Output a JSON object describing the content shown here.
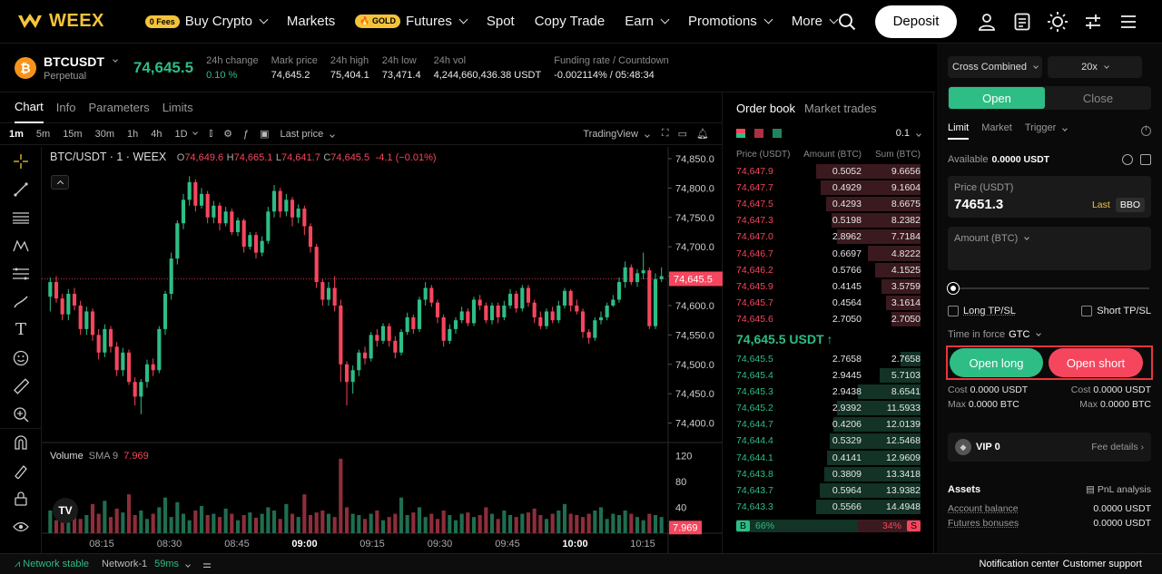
{
  "nav": {
    "logo": "WEEX",
    "fees_badge": "0 Fees",
    "buy_crypto": "Buy Crypto",
    "markets": "Markets",
    "gold_badge": "GOLD",
    "futures": "Futures",
    "spot": "Spot",
    "copy_trade": "Copy Trade",
    "earn": "Earn",
    "promotions": "Promotions",
    "more": "More",
    "deposit": "Deposit"
  },
  "ticker": {
    "symbol": "BTCUSDT",
    "type": "Perpetual",
    "price": "74,645.5",
    "change_label": "24h change",
    "change_value": "0.10 %",
    "mark_label": "Mark price",
    "mark_value": "74,645.2",
    "high_label": "24h high",
    "high_value": "75,404.1",
    "low_label": "24h low",
    "low_value": "73,471.4",
    "vol_label": "24h vol",
    "vol_value": "4,244,660,436.38 USDT",
    "funding_label": "Funding rate / Countdown",
    "funding_value": "-0.002114% / 05:48:34"
  },
  "chart_panel": {
    "tabs": [
      "Chart",
      "Info",
      "Parameters",
      "Limits"
    ],
    "timeframes": [
      "1m",
      "5m",
      "15m",
      "30m",
      "1h",
      "4h",
      "1D"
    ],
    "last_price": "Last price",
    "tradingview": "TradingView",
    "legend_title": "BTC/USDT · 1 · WEEX",
    "ohlc": {
      "o": "74,649.6",
      "h": "74,665.1",
      "l": "74,641.7",
      "c": "74,645.5",
      "chg": "-4.1 (−0.01%)"
    },
    "volume_label": "Volume",
    "sma_label": "SMA 9",
    "sma_value": "7.969",
    "volume_tag": "7.969",
    "price_tag": "74,645.5"
  },
  "chart_data": {
    "type": "candlestick",
    "y_ticks": [
      "74,850.0",
      "74,800.0",
      "74,750.0",
      "74,700.0",
      "74,650.0",
      "74,600.0",
      "74,550.0",
      "74,500.0",
      "74,450.0",
      "74,400.0"
    ],
    "ylim": [
      74370,
      74870
    ],
    "x_ticks": [
      "08:15",
      "08:30",
      "08:45",
      "09:00",
      "09:15",
      "09:30",
      "09:45",
      "10:00",
      "10:15"
    ],
    "volume_ticks": [
      "120",
      "80",
      "40"
    ],
    "volume_ylim": [
      0,
      140
    ],
    "last_price": 74645.5,
    "candles": [
      [
        74615,
        74640,
        74590,
        74648
      ],
      [
        74640,
        74612,
        74605,
        74650
      ],
      [
        74612,
        74585,
        74575,
        74620
      ],
      [
        74585,
        74620,
        74575,
        74628
      ],
      [
        74620,
        74600,
        74592,
        74630
      ],
      [
        74600,
        74560,
        74550,
        74608
      ],
      [
        74560,
        74590,
        74550,
        74598
      ],
      [
        74590,
        74550,
        74540,
        74595
      ],
      [
        74550,
        74520,
        74508,
        74560
      ],
      [
        74520,
        74560,
        74512,
        74568
      ],
      [
        74560,
        74530,
        74520,
        74565
      ],
      [
        74530,
        74490,
        74480,
        74538
      ],
      [
        74490,
        74520,
        74480,
        74528
      ],
      [
        74520,
        74470,
        74465,
        74525
      ],
      [
        74470,
        74445,
        74430,
        74478
      ],
      [
        74445,
        74470,
        74415,
        74475
      ],
      [
        74470,
        74500,
        74460,
        74508
      ],
      [
        74500,
        74490,
        74480,
        74510
      ],
      [
        74490,
        74560,
        74485,
        74565
      ],
      [
        74560,
        74620,
        74550,
        74625
      ],
      [
        74620,
        74680,
        74610,
        74690
      ],
      [
        74680,
        74740,
        74670,
        74745
      ],
      [
        74740,
        74780,
        74730,
        74790
      ],
      [
        74780,
        74810,
        74770,
        74820
      ],
      [
        74810,
        74770,
        74760,
        74815
      ],
      [
        74770,
        74790,
        74765,
        74800
      ],
      [
        74790,
        74750,
        74740,
        74795
      ],
      [
        74750,
        74770,
        74740,
        74778
      ],
      [
        74770,
        74740,
        74728,
        74775
      ],
      [
        74740,
        74760,
        74735,
        74768
      ],
      [
        74760,
        74725,
        74720,
        74765
      ],
      [
        74725,
        74745,
        74718,
        74750
      ],
      [
        74745,
        74700,
        74690,
        74748
      ],
      [
        74700,
        74720,
        74695,
        74725
      ],
      [
        74720,
        74690,
        74680,
        74725
      ],
      [
        74690,
        74710,
        74684,
        74718
      ],
      [
        74710,
        74760,
        74705,
        74768
      ],
      [
        74760,
        74795,
        74750,
        74805
      ],
      [
        74795,
        74760,
        74750,
        74800
      ],
      [
        74760,
        74780,
        74752,
        74790
      ],
      [
        74780,
        74750,
        74735,
        74785
      ],
      [
        74750,
        74765,
        74740,
        74772
      ],
      [
        74765,
        74735,
        74720,
        74770
      ],
      [
        74735,
        74700,
        74690,
        74740
      ],
      [
        74700,
        74640,
        74630,
        74705
      ],
      [
        74640,
        74610,
        74600,
        74645
      ],
      [
        74610,
        74630,
        74600,
        74640
      ],
      [
        74630,
        74600,
        74590,
        74650
      ],
      [
        74600,
        74500,
        74470,
        74610
      ],
      [
        74500,
        74470,
        74430,
        74505
      ],
      [
        74470,
        74490,
        74450,
        74498
      ],
      [
        74490,
        74520,
        74480,
        74525
      ],
      [
        74520,
        74510,
        74500,
        74530
      ],
      [
        74510,
        74550,
        74505,
        74555
      ],
      [
        74550,
        74540,
        74530,
        74560
      ],
      [
        74540,
        74565,
        74535,
        74570
      ],
      [
        74565,
        74540,
        74530,
        74570
      ],
      [
        74540,
        74520,
        74510,
        74548
      ],
      [
        74520,
        74555,
        74515,
        74560
      ],
      [
        74555,
        74580,
        74550,
        74588
      ],
      [
        74580,
        74560,
        74552,
        74585
      ],
      [
        74560,
        74610,
        74555,
        74615
      ],
      [
        74610,
        74630,
        74600,
        74640
      ],
      [
        74630,
        74605,
        74598,
        74635
      ],
      [
        74605,
        74580,
        74570,
        74610
      ],
      [
        74580,
        74540,
        74530,
        74585
      ],
      [
        74540,
        74560,
        74535,
        74568
      ],
      [
        74560,
        74575,
        74552,
        74580
      ],
      [
        74575,
        74590,
        74570,
        74598
      ],
      [
        74590,
        74570,
        74565,
        74595
      ],
      [
        74570,
        74610,
        74565,
        74615
      ],
      [
        74610,
        74600,
        74592,
        74618
      ],
      [
        74600,
        74575,
        74570,
        74605
      ],
      [
        74575,
        74600,
        74568,
        74605
      ],
      [
        74600,
        74580,
        74570,
        74605
      ],
      [
        74580,
        74600,
        74575,
        74608
      ],
      [
        74600,
        74620,
        74595,
        74628
      ],
      [
        74620,
        74595,
        74588,
        74625
      ],
      [
        74595,
        74630,
        74590,
        74635
      ],
      [
        74630,
        74605,
        74598,
        74635
      ],
      [
        74605,
        74580,
        74570,
        74610
      ],
      [
        74580,
        74565,
        74560,
        74590
      ],
      [
        74565,
        74590,
        74560,
        74595
      ],
      [
        74590,
        74575,
        74570,
        74598
      ],
      [
        74575,
        74600,
        74570,
        74608
      ],
      [
        74600,
        74625,
        74595,
        74630
      ],
      [
        74625,
        74600,
        74590,
        74628
      ],
      [
        74600,
        74590,
        74585,
        74610
      ],
      [
        74590,
        74555,
        74545,
        74595
      ],
      [
        74555,
        74545,
        74535,
        74560
      ],
      [
        74545,
        74575,
        74540,
        74580
      ],
      [
        74575,
        74580,
        74568,
        74590
      ],
      [
        74580,
        74600,
        74575,
        74605
      ],
      [
        74600,
        74610,
        74598,
        74618
      ],
      [
        74610,
        74640,
        74605,
        74648
      ],
      [
        74640,
        74665,
        74630,
        74675
      ],
      [
        74665,
        74640,
        74635,
        74670
      ],
      [
        74640,
        74655,
        74632,
        74662
      ],
      [
        74655,
        74660,
        74645,
        74690
      ],
      [
        74660,
        74565,
        74560,
        74665
      ],
      [
        74565,
        74645,
        74560,
        74655
      ],
      [
        74645,
        74650,
        74640,
        74665
      ]
    ],
    "volumes": [
      35,
      20,
      25,
      18,
      40,
      22,
      28,
      45,
      30,
      50,
      25,
      38,
      32,
      60,
      28,
      35,
      22,
      30,
      40,
      55,
      25,
      48,
      30,
      20,
      35,
      42,
      28,
      30,
      25,
      38,
      30,
      20,
      28,
      32,
      24,
      30,
      40,
      35,
      22,
      45,
      30,
      25,
      60,
      28,
      32,
      35,
      30,
      25,
      115,
      40,
      30,
      28,
      22,
      30,
      35,
      20,
      25,
      30,
      55,
      28,
      32,
      40,
      25,
      30,
      22,
      35,
      28,
      20,
      30,
      32,
      25,
      28,
      40,
      30,
      22,
      35,
      28,
      25,
      30,
      32,
      38,
      28,
      22,
      30,
      35,
      45,
      30,
      28,
      25,
      30,
      35,
      40,
      22,
      30,
      28,
      35,
      30,
      25,
      20,
      30,
      28,
      25
    ]
  },
  "orderbook": {
    "tab_active": "Order book",
    "tab_trades": "Market trades",
    "precision": "0.1",
    "col_price": "Price (USDT)",
    "col_amount": "Amount (BTC)",
    "col_sum": "Sum (BTC)",
    "asks": [
      {
        "p": "74,647.9",
        "a": "0.5052",
        "s": "9.6656",
        "depth": 1.0
      },
      {
        "p": "74,647.7",
        "a": "0.4929",
        "s": "9.1604",
        "depth": 0.95
      },
      {
        "p": "74,647.5",
        "a": "0.4293",
        "s": "8.6675",
        "depth": 0.9
      },
      {
        "p": "74,647.3",
        "a": "0.5198",
        "s": "8.2382",
        "depth": 0.85
      },
      {
        "p": "74,647.0",
        "a": "2.8962",
        "s": "7.7184",
        "depth": 0.8
      },
      {
        "p": "74,646.7",
        "a": "0.6697",
        "s": "4.8222",
        "depth": 0.5
      },
      {
        "p": "74,646.2",
        "a": "0.5766",
        "s": "4.1525",
        "depth": 0.43
      },
      {
        "p": "74,645.9",
        "a": "0.4145",
        "s": "3.5759",
        "depth": 0.37
      },
      {
        "p": "74,645.7",
        "a": "0.4564",
        "s": "3.1614",
        "depth": 0.33
      },
      {
        "p": "74,645.6",
        "a": "2.7050",
        "s": "2.7050",
        "depth": 0.28
      }
    ],
    "mid_price": "74,645.5 USDT",
    "bids": [
      {
        "p": "74,645.5",
        "a": "2.7658",
        "s": "2.7658",
        "depth": 0.19
      },
      {
        "p": "74,645.4",
        "a": "2.9445",
        "s": "5.7103",
        "depth": 0.39
      },
      {
        "p": "74,645.3",
        "a": "2.9438",
        "s": "8.6541",
        "depth": 0.6
      },
      {
        "p": "74,645.2",
        "a": "2.9392",
        "s": "11.5933",
        "depth": 0.8
      },
      {
        "p": "74,644.7",
        "a": "0.4206",
        "s": "12.0139",
        "depth": 0.83
      },
      {
        "p": "74,644.4",
        "a": "0.5329",
        "s": "12.5468",
        "depth": 0.87
      },
      {
        "p": "74,644.1",
        "a": "0.4141",
        "s": "12.9609",
        "depth": 0.89
      },
      {
        "p": "74,643.8",
        "a": "0.3809",
        "s": "13.3418",
        "depth": 0.92
      },
      {
        "p": "74,643.7",
        "a": "0.5964",
        "s": "13.9382",
        "depth": 0.96
      },
      {
        "p": "74,643.3",
        "a": "0.5566",
        "s": "14.4948",
        "depth": 1.0
      }
    ],
    "buy_label": "B",
    "buy_pct": "66%",
    "sell_pct": "34%",
    "sell_label": "S",
    "buy_ratio": 0.66
  },
  "trade": {
    "margin_mode": "Cross Combined",
    "leverage": "20x",
    "open": "Open",
    "close": "Close",
    "order_types": [
      "Limit",
      "Market",
      "Trigger"
    ],
    "available_label": "Available",
    "available_value": "0.0000 USDT",
    "price_label": "Price (USDT)",
    "price_value": "74651.3",
    "last": "Last",
    "bbo": "BBO",
    "amount_label": "Amount (BTC)",
    "long_tpsl": "Long TP/SL",
    "short_tpsl": "Short TP/SL",
    "tif_label": "Time in force",
    "tif_value": "GTC",
    "open_long": "Open long",
    "open_short": "Open short",
    "cost_label": "Cost",
    "cost_long": "0.0000 USDT",
    "cost_short": "0.0000 USDT",
    "max_label": "Max",
    "max_long": "0.0000 BTC",
    "max_short": "0.0000 BTC",
    "vip": "VIP 0",
    "fee_details": "Fee details",
    "assets": "Assets",
    "pnl_analysis": "PnL analysis",
    "account_balance_label": "Account balance",
    "account_balance_value": "0.0000 USDT",
    "futures_bonus_label": "Futures bonuses",
    "futures_bonus_value": "0.0000 USDT"
  },
  "status": {
    "network": "Network stable",
    "network_name": "Network-1",
    "latency": "59ms",
    "notification": "Notification center",
    "support": "Customer support"
  },
  "colors": {
    "up": "#2ebd85",
    "down": "#f6465d",
    "brand": "#f5c33b"
  }
}
